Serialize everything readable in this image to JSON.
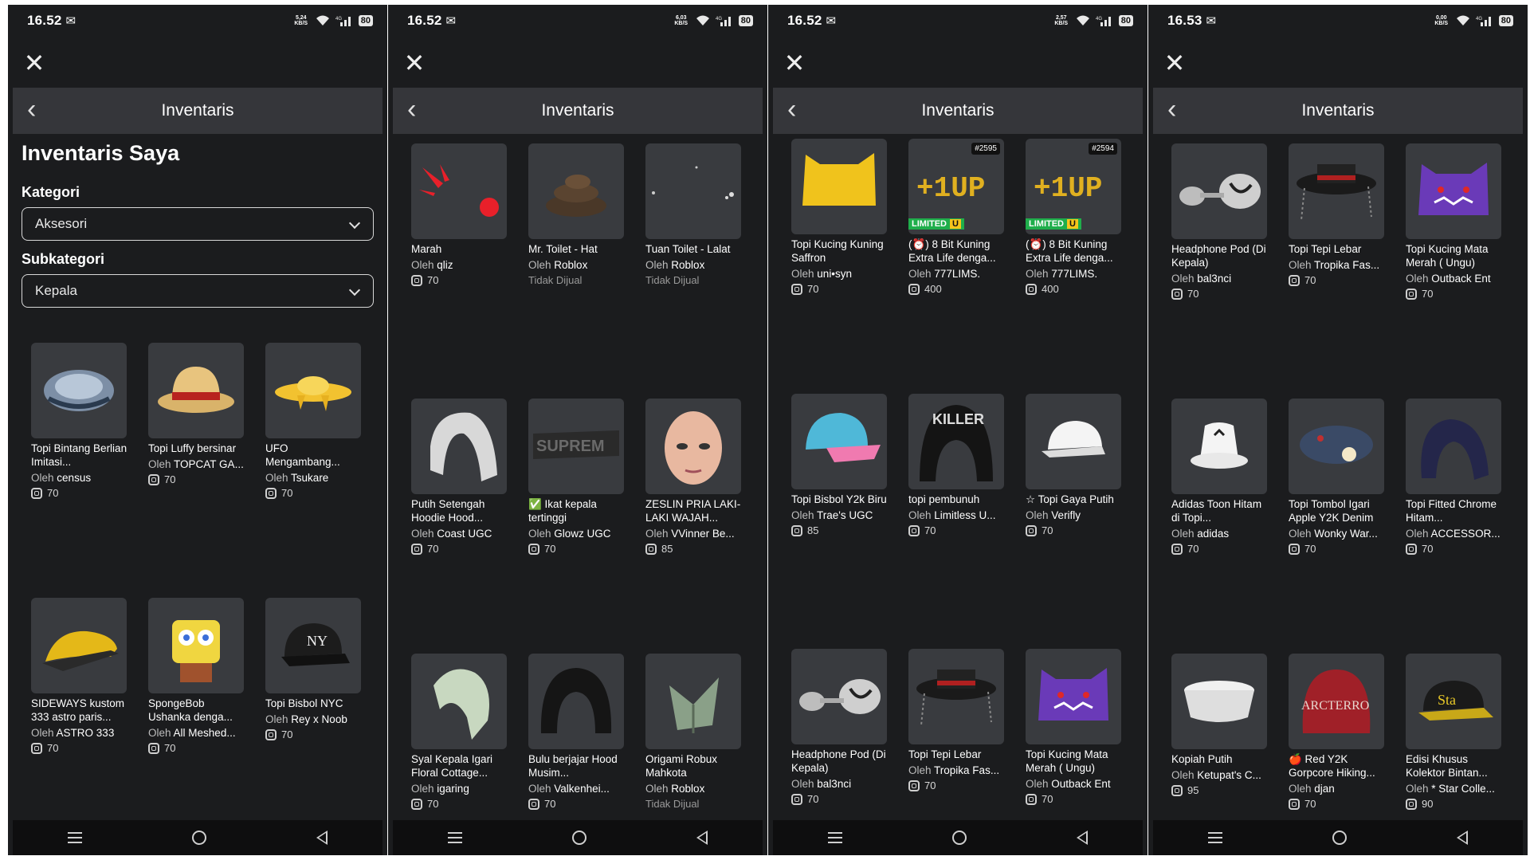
{
  "status_bars": [
    {
      "time": "16.52",
      "net": "5,24 KB/S",
      "battery": "80"
    },
    {
      "time": "16.52",
      "net": "6,03 KB/S",
      "battery": "80"
    },
    {
      "time": "16.52",
      "net": "2,57 KB/S",
      "battery": "80"
    },
    {
      "time": "16.53",
      "net": "0,00 KB/S",
      "battery": "80"
    }
  ],
  "header_title": "Inventaris",
  "inventory": {
    "title": "Inventaris Saya",
    "category_label": "Kategori",
    "category_value": "Aksesori",
    "subcategory_label": "Subkategori",
    "subcategory_value": "Kepala"
  },
  "creator_prefix": "Oleh",
  "screens": [
    {
      "items": [
        {
          "name": "Topi Bintang Berlian Imitasi...",
          "creator": "census",
          "price": "70"
        },
        {
          "name": "Topi Luffy bersinar",
          "creator": "TOPCAT GA...",
          "price": "70"
        },
        {
          "name": "UFO Mengambang...",
          "creator": "Tsukare",
          "price": "70"
        },
        {
          "name": "SIDEWAYS kustom 333 astro paris...",
          "creator": "ASTRO 333",
          "price": "70"
        },
        {
          "name": "SpongeBob Ushanka denga...",
          "creator": "All Meshed...",
          "price": "70"
        },
        {
          "name": "Topi Bisbol NYC",
          "creator": "Rey x Noob",
          "price": "70"
        }
      ]
    },
    {
      "items": [
        {
          "name": "Marah",
          "creator": "qliz",
          "price": "70"
        },
        {
          "name": "Mr. Toilet - Hat",
          "creator": "Roblox",
          "price": "",
          "status": "Tidak Dijual"
        },
        {
          "name": "Tuan Toilet - Lalat",
          "creator": "Roblox",
          "price": "",
          "status": "Tidak Dijual"
        },
        {
          "name": "Putih Setengah Hoodie Hood...",
          "creator": "Coast UGC",
          "price": "70"
        },
        {
          "name": "✅ Ikat kepala tertinggi",
          "creator": "Glowz UGC",
          "price": "70"
        },
        {
          "name": "ZESLIN PRIA LAKI-LAKI WAJAH...",
          "creator": "VVinner Be...",
          "price": "85"
        },
        {
          "name": "Syal Kepala Igari Floral Cottage...",
          "creator": "igaring",
          "price": "70"
        },
        {
          "name": "Bulu berjajar Hood Musim...",
          "creator": "Valkenhei...",
          "price": "70"
        },
        {
          "name": "Origami Robux Mahkota",
          "creator": "Roblox",
          "price": "",
          "status": "Tidak Dijual"
        }
      ]
    },
    {
      "items": [
        {
          "name": "Topi Kucing Kuning Saffron",
          "creator": "uni•syn",
          "price": "70"
        },
        {
          "name": "(⏰) 8 Bit Kuning Extra Life denga...",
          "creator": "777LIMS.",
          "price": "400",
          "serial": "#2595",
          "limited": "LIMITED",
          "limited_u": "U"
        },
        {
          "name": "(⏰) 8 Bit Kuning Extra Life denga...",
          "creator": "777LIMS.",
          "price": "400",
          "serial": "#2594",
          "limited": "LIMITED",
          "limited_u": "U"
        },
        {
          "name": "Topi Bisbol Y2k Biru",
          "creator": "Trae's UGC",
          "price": "85"
        },
        {
          "name": "topi pembunuh",
          "creator": "Limitless U...",
          "price": "70"
        },
        {
          "name": "☆ Topi Gaya Putih",
          "creator": "Verifly",
          "price": "70"
        },
        {
          "name": "Headphone Pod (Di Kepala)",
          "creator": "bal3nci",
          "price": "70"
        },
        {
          "name": "Topi Tepi Lebar",
          "creator": "Tropika Fas...",
          "price": "70"
        },
        {
          "name": "Topi Kucing Mata Merah ( Ungu)",
          "creator": "Outback Ent",
          "price": "70"
        }
      ]
    },
    {
      "items": [
        {
          "name": "Headphone Pod (Di Kepala)",
          "creator": "bal3nci",
          "price": "70"
        },
        {
          "name": "Topi Tepi Lebar",
          "creator": "Tropika Fas...",
          "price": "70"
        },
        {
          "name": "Topi Kucing Mata Merah ( Ungu)",
          "creator": "Outback Ent",
          "price": "70"
        },
        {
          "name": "Adidas Toon Hitam di Topi...",
          "creator": "adidas",
          "price": "70"
        },
        {
          "name": "Topi Tombol Igari Apple Y2K Denim",
          "creator": "Wonky War...",
          "price": "70"
        },
        {
          "name": "Topi Fitted Chrome Hitam...",
          "creator": "ACCESSOR...",
          "price": "70"
        },
        {
          "name": "Kopiah Putih",
          "creator": "Ketupat's C...",
          "price": "95"
        },
        {
          "name": "🍎 Red Y2K Gorpcore Hiking...",
          "creator": "djan",
          "price": "70"
        },
        {
          "name": "Edisi Khusus Kolektor Bintan...",
          "creator": "* Star Colle...",
          "price": "90"
        }
      ]
    }
  ],
  "colors": {
    "background": "#1b1c1e",
    "header": "#35363a",
    "thumb": "#393b3f",
    "navbar": "#0e0e0f"
  }
}
